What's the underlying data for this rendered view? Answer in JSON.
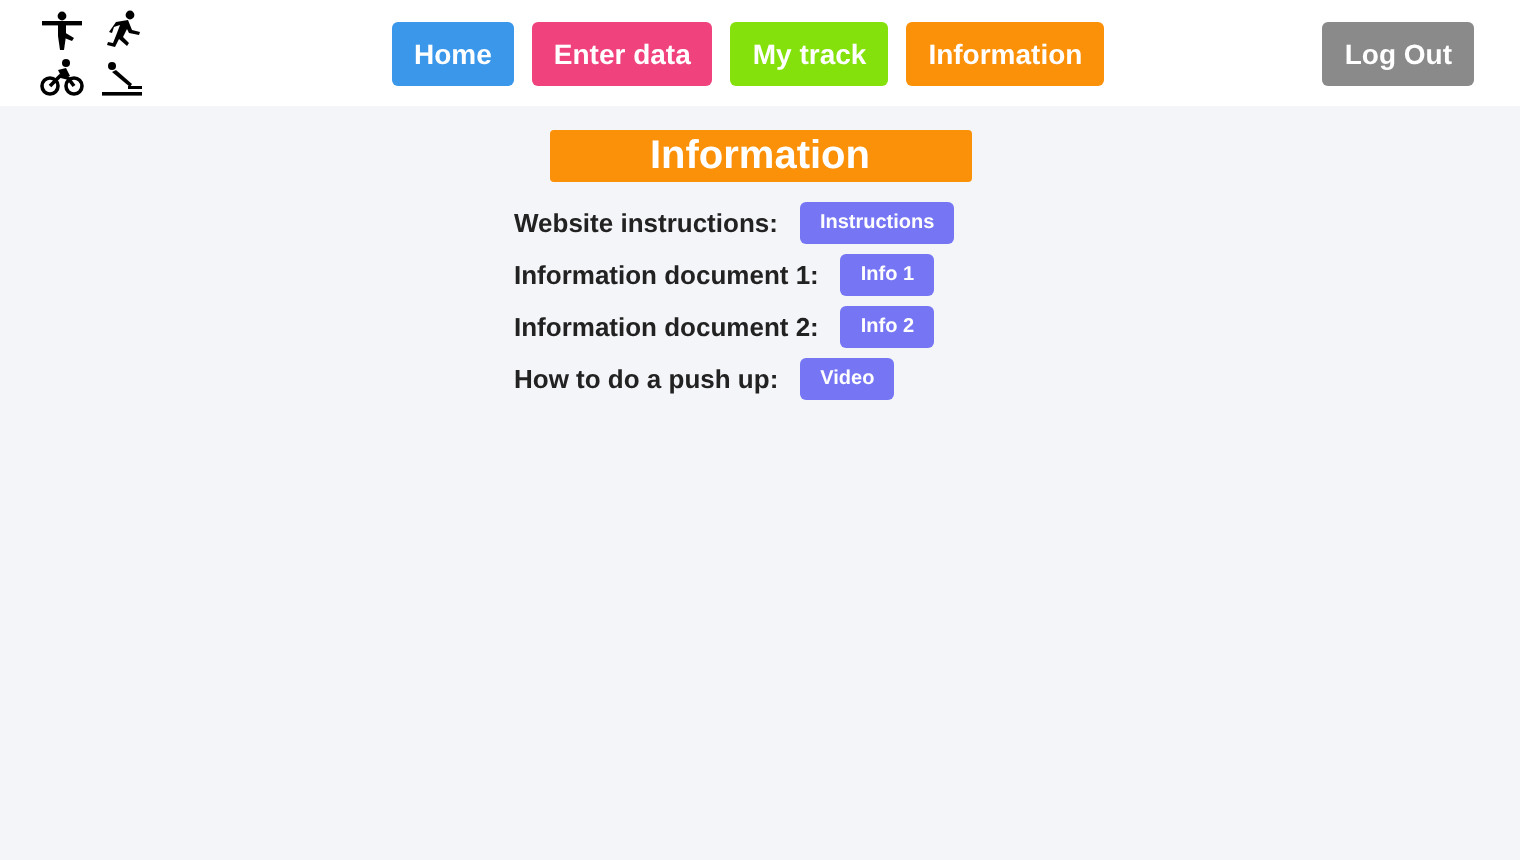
{
  "nav": [
    {
      "label": "Home",
      "color": "#3a97ea"
    },
    {
      "label": "Enter data",
      "color": "#f0437e"
    },
    {
      "label": "My track",
      "color": "#84e10c"
    },
    {
      "label": "Information",
      "color": "#fb9009"
    }
  ],
  "logout": {
    "label": "Log Out"
  },
  "title": "Information",
  "rows": [
    {
      "label": "Website instructions:",
      "button": "Instructions"
    },
    {
      "label": "Information document 1:",
      "button": "Info 1"
    },
    {
      "label": "Information document 2:",
      "button": "Info 2"
    },
    {
      "label": "How to do a push up:",
      "button": "Video"
    }
  ]
}
